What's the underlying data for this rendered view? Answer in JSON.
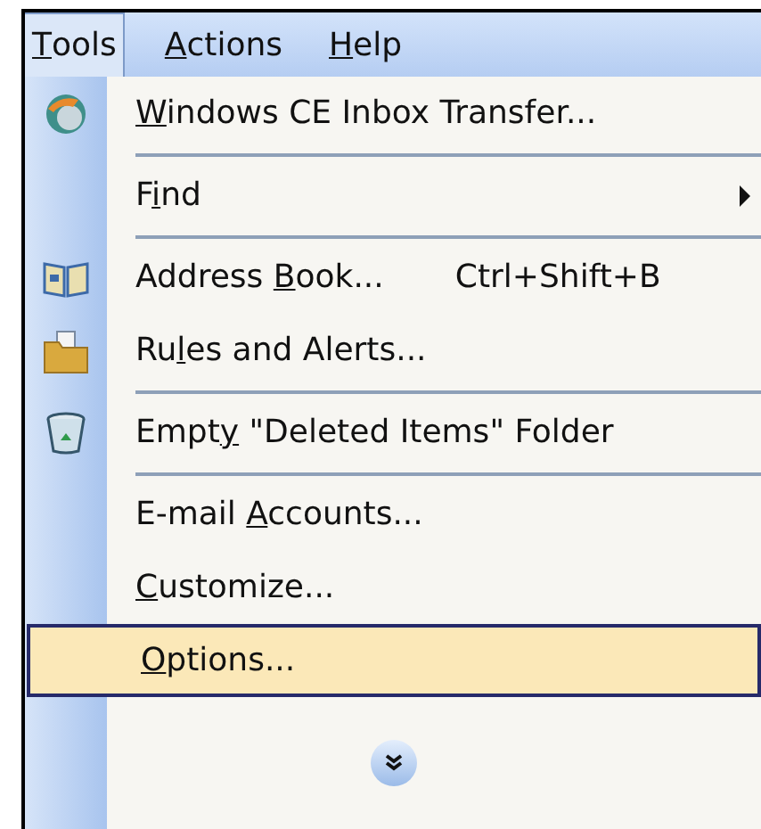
{
  "menu_bar": [
    {
      "label": {
        "key": "T",
        "after": "ools"
      },
      "selected": true
    },
    {
      "label": {
        "key": "A",
        "after": "ctions"
      },
      "selected": false
    },
    {
      "label": {
        "key": "H",
        "after": "elp"
      },
      "selected": false
    }
  ],
  "menu": {
    "items": [
      {
        "kind": "item",
        "label": {
          "key": "W",
          "after": "indows CE Inbox Transfer..."
        },
        "selected": false
      },
      {
        "kind": "separator"
      },
      {
        "kind": "item",
        "label": {
          "before": "F",
          "key": "i",
          "after": "nd"
        },
        "submenu": true,
        "selected": false
      },
      {
        "kind": "separator"
      },
      {
        "kind": "item",
        "label": {
          "before": "Address ",
          "key": "B",
          "after": "ook..."
        },
        "shortcut": "Ctrl+Shift+B",
        "selected": false
      },
      {
        "kind": "item",
        "label": {
          "before": "Ru",
          "key": "l",
          "after": "es and Alerts..."
        },
        "selected": false
      },
      {
        "kind": "separator"
      },
      {
        "kind": "item",
        "label": {
          "before": "Empt",
          "key": "y",
          "after": " \"Deleted Items\" Folder"
        },
        "selected": false
      },
      {
        "kind": "separator"
      },
      {
        "kind": "item",
        "label": {
          "before": "E-mail ",
          "key": "A",
          "after": "ccounts..."
        },
        "selected": false
      },
      {
        "kind": "item",
        "label": {
          "key": "C",
          "after": "ustomize..."
        },
        "selected": false
      },
      {
        "kind": "item",
        "label": {
          "key": "O",
          "after": "ptions..."
        },
        "selected": true
      },
      {
        "kind": "expand"
      }
    ]
  }
}
